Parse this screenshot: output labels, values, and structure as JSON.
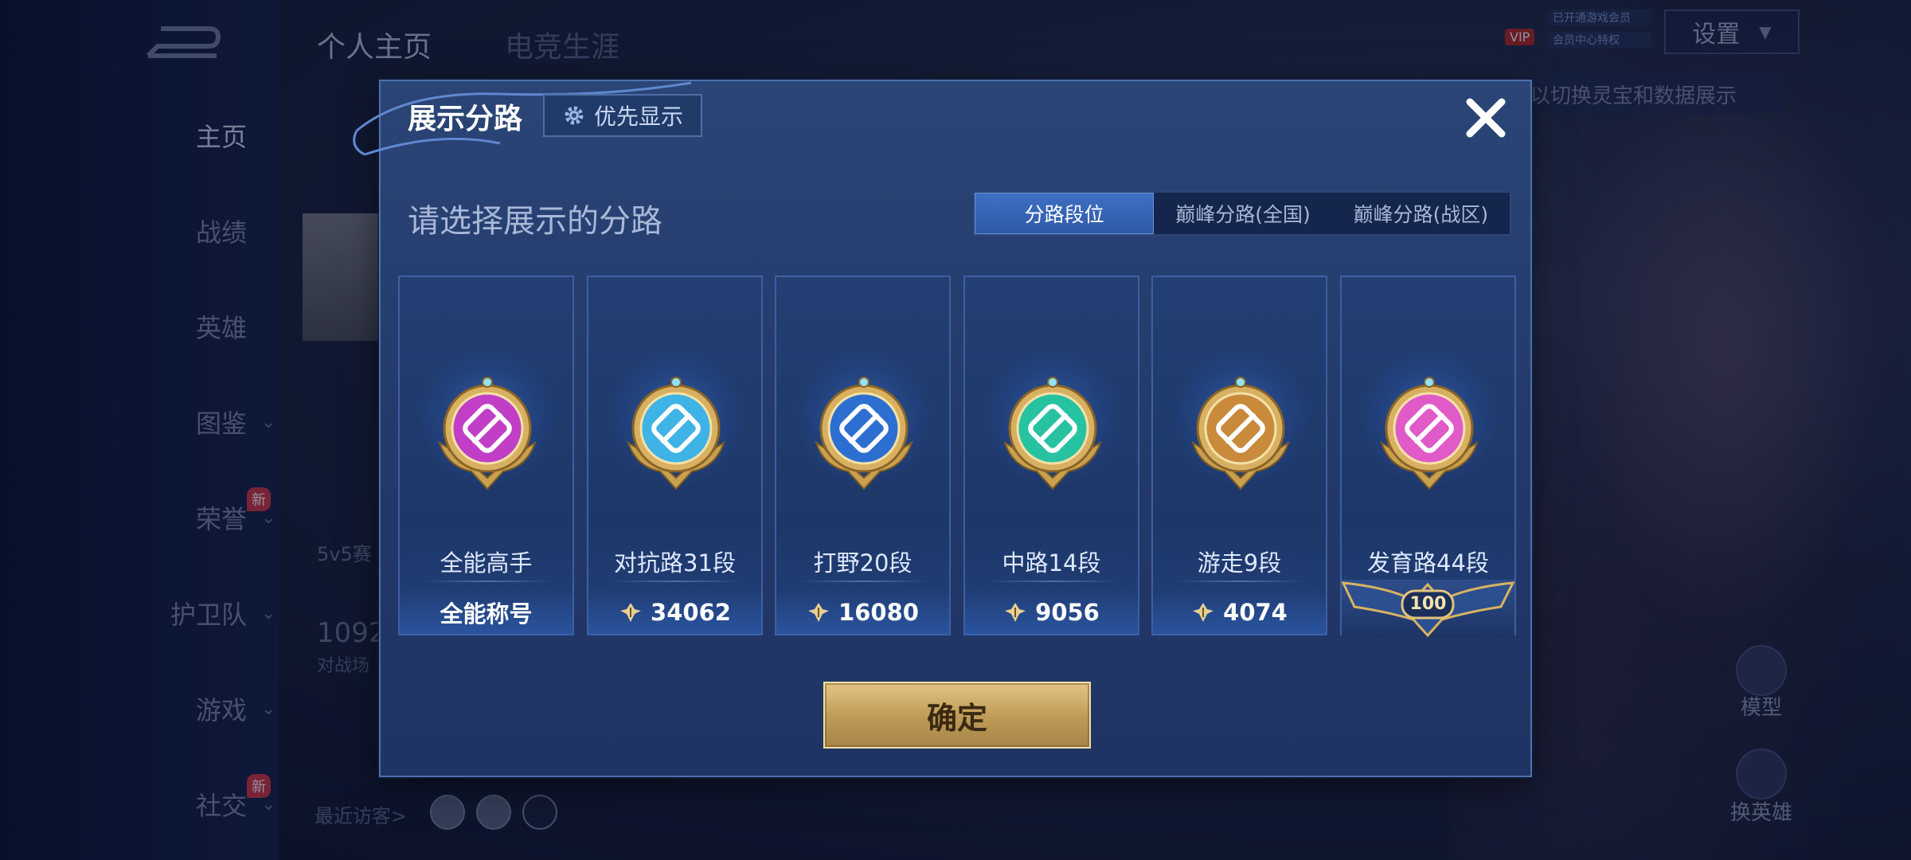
{
  "background": {
    "top_tabs": [
      "个人主页",
      "电竞生涯"
    ],
    "settings_label": "设置",
    "vip_text": "VIP",
    "vip_lines": [
      "已开通游戏会员",
      "会员中心特权"
    ],
    "hint_text": "以切换灵宝和数据展示",
    "side_nav": [
      {
        "label": "主页",
        "chevron": false,
        "new": false,
        "active": true
      },
      {
        "label": "战绩",
        "chevron": false,
        "new": false,
        "active": false
      },
      {
        "label": "英雄",
        "chevron": false,
        "new": false,
        "active": false
      },
      {
        "label": "图鉴",
        "chevron": true,
        "new": false,
        "active": false
      },
      {
        "label": "荣誉",
        "chevron": true,
        "new": true,
        "active": false
      },
      {
        "label": "护卫队",
        "chevron": true,
        "new": false,
        "active": false
      },
      {
        "label": "游戏",
        "chevron": true,
        "new": false,
        "active": false
      },
      {
        "label": "社交",
        "chevron": true,
        "new": true,
        "active": false
      }
    ],
    "new_tag": "新",
    "mode_label": "5v5赛",
    "stat_value": "1092",
    "stat_label": "对战场",
    "recent_visitors_label": "最近访客>",
    "right_labels": [
      "模型",
      "换英雄"
    ]
  },
  "modal": {
    "title": "展示分路",
    "priority_button": "优先显示",
    "subtitle": "请选择展示的分路",
    "tabs": [
      {
        "label": "分路段位",
        "active": true
      },
      {
        "label": "巅峰分路(全国)",
        "active": false
      },
      {
        "label": "巅峰分路(战区)",
        "active": false
      }
    ],
    "cards": [
      {
        "role": "全能高手",
        "bottom_text": "全能称号",
        "points": null,
        "icon": "all-round-emblem-icon",
        "color": "#c13ec6"
      },
      {
        "role": "对抗路31段",
        "bottom_text": null,
        "points": "34062",
        "icon": "clash-lane-emblem-icon",
        "color": "#3fb3e6"
      },
      {
        "role": "打野20段",
        "bottom_text": null,
        "points": "16080",
        "icon": "jungle-emblem-icon",
        "color": "#2d6fd1"
      },
      {
        "role": "中路14段",
        "bottom_text": null,
        "points": "9056",
        "icon": "mid-lane-emblem-icon",
        "color": "#27c2a0"
      },
      {
        "role": "游走9段",
        "bottom_text": null,
        "points": "4074",
        "icon": "roam-emblem-icon",
        "color": "#c98a3c"
      },
      {
        "role": "发育路44段",
        "bottom_text": null,
        "points": null,
        "rank_badge": "100",
        "icon": "farm-lane-emblem-icon",
        "color": "#e05ac8"
      }
    ],
    "confirm_button": "确定"
  }
}
